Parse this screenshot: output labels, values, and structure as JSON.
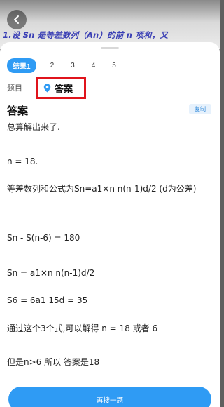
{
  "photo": {
    "question_text": "1.设 Sn 是等差数列（An）的前 n 项和，又"
  },
  "tabs": [
    "结果1",
    "2",
    "3",
    "4",
    "5"
  ],
  "section": {
    "label": "题目",
    "answer_tab": "答案"
  },
  "answer": {
    "title": "答案",
    "copy_label": "复制",
    "lines": [
      "总算解出来了.",
      "n = 18.",
      "等差数列和公式为Sn=a1×n n(n-1)d/2 (d为公差)",
      "Sn - S(n-6) = 180",
      "Sn = a1×n n(n-1)d/2",
      "S6 = 6a1 15d = 35",
      "通过这个3个式,可以解得 n = 18 或者 6",
      "但是n>6 所以 答案是18"
    ]
  },
  "bottom_button": "再搜一题",
  "colors": {
    "accent": "#2f9bf4",
    "highlight_box": "#e0141c",
    "question_text": "#3a3fb5"
  }
}
